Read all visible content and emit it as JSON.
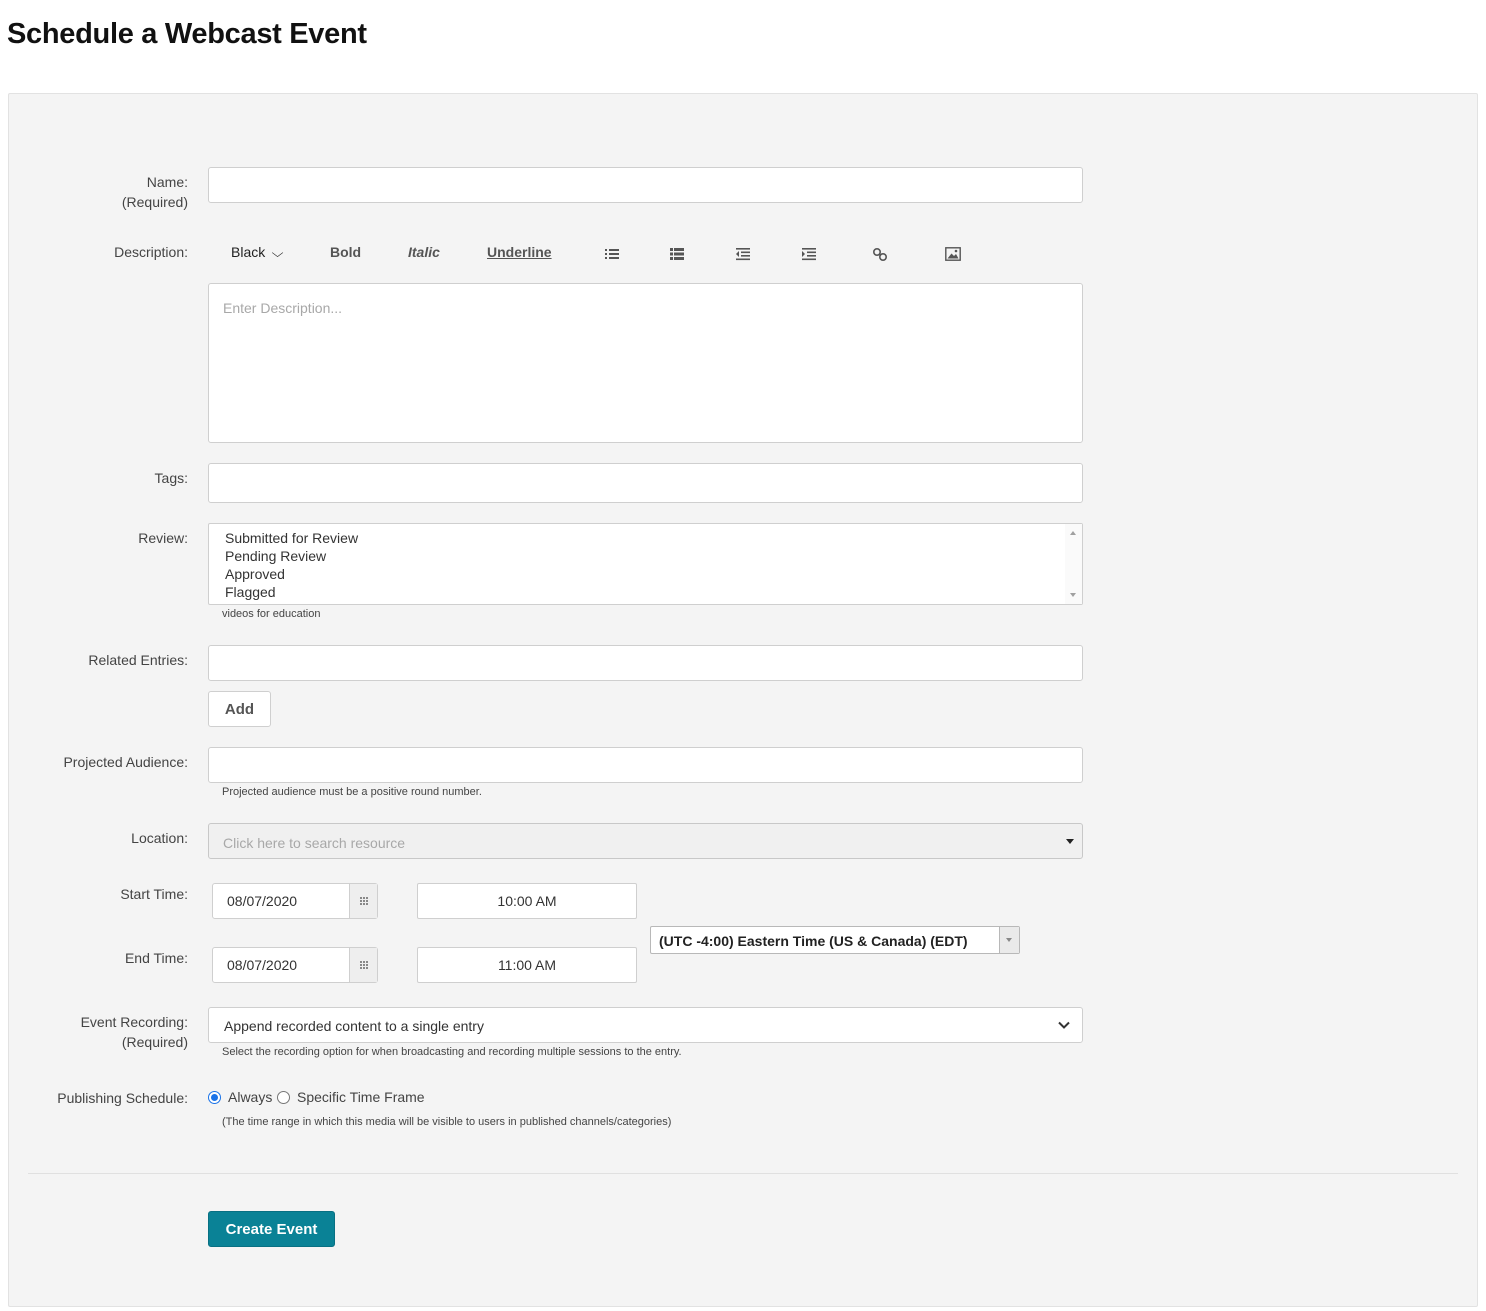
{
  "page": {
    "title": "Schedule a Webcast Event"
  },
  "labels": {
    "name": "Name:",
    "required": "(Required)",
    "description": "Description:",
    "tags": "Tags:",
    "review": "Review:",
    "related_entries": "Related Entries:",
    "projected_audience": "Projected Audience:",
    "location": "Location:",
    "start_time": "Start Time:",
    "end_time": "End Time:",
    "event_recording": "Event Recording:",
    "publishing_schedule": "Publishing Schedule:"
  },
  "toolbar": {
    "color": "Black",
    "bold": "Bold",
    "italic": "Italic",
    "underline": "Underline",
    "icons": [
      "unordered-list-icon",
      "ordered-list-icon",
      "outdent-icon",
      "indent-icon",
      "link-icon",
      "image-icon"
    ]
  },
  "fields": {
    "name_value": "",
    "description_placeholder": "Enter Description...",
    "tags_value": "",
    "related_entries_value": "",
    "projected_audience_value": ""
  },
  "review": {
    "options": [
      "Submitted for Review",
      "Pending Review",
      "Approved",
      "Flagged"
    ],
    "help": "videos for education"
  },
  "buttons": {
    "add": "Add",
    "create_event": "Create Event"
  },
  "audience_help": "Projected audience must be a positive round number.",
  "location": {
    "placeholder": "Click here to search resource"
  },
  "start": {
    "date": "08/07/2020",
    "time": "10:00 AM"
  },
  "end": {
    "date": "08/07/2020",
    "time": "11:00 AM"
  },
  "timezone": {
    "value": "(UTC -4:00) Eastern Time (US & Canada) (EDT)"
  },
  "recording": {
    "value": "Append recorded content to a single entry",
    "help": "Select the recording option for when broadcasting and recording multiple sessions to the entry."
  },
  "publishing": {
    "options": [
      "Always",
      "Specific Time Frame"
    ],
    "selected": "Always",
    "help": "(The time range in which this media will be visible to users in published channels/categories)"
  },
  "colors": {
    "primary_button": "#0a8296",
    "radio_accent": "#1a73e8",
    "panel_bg": "#f4f4f4"
  }
}
